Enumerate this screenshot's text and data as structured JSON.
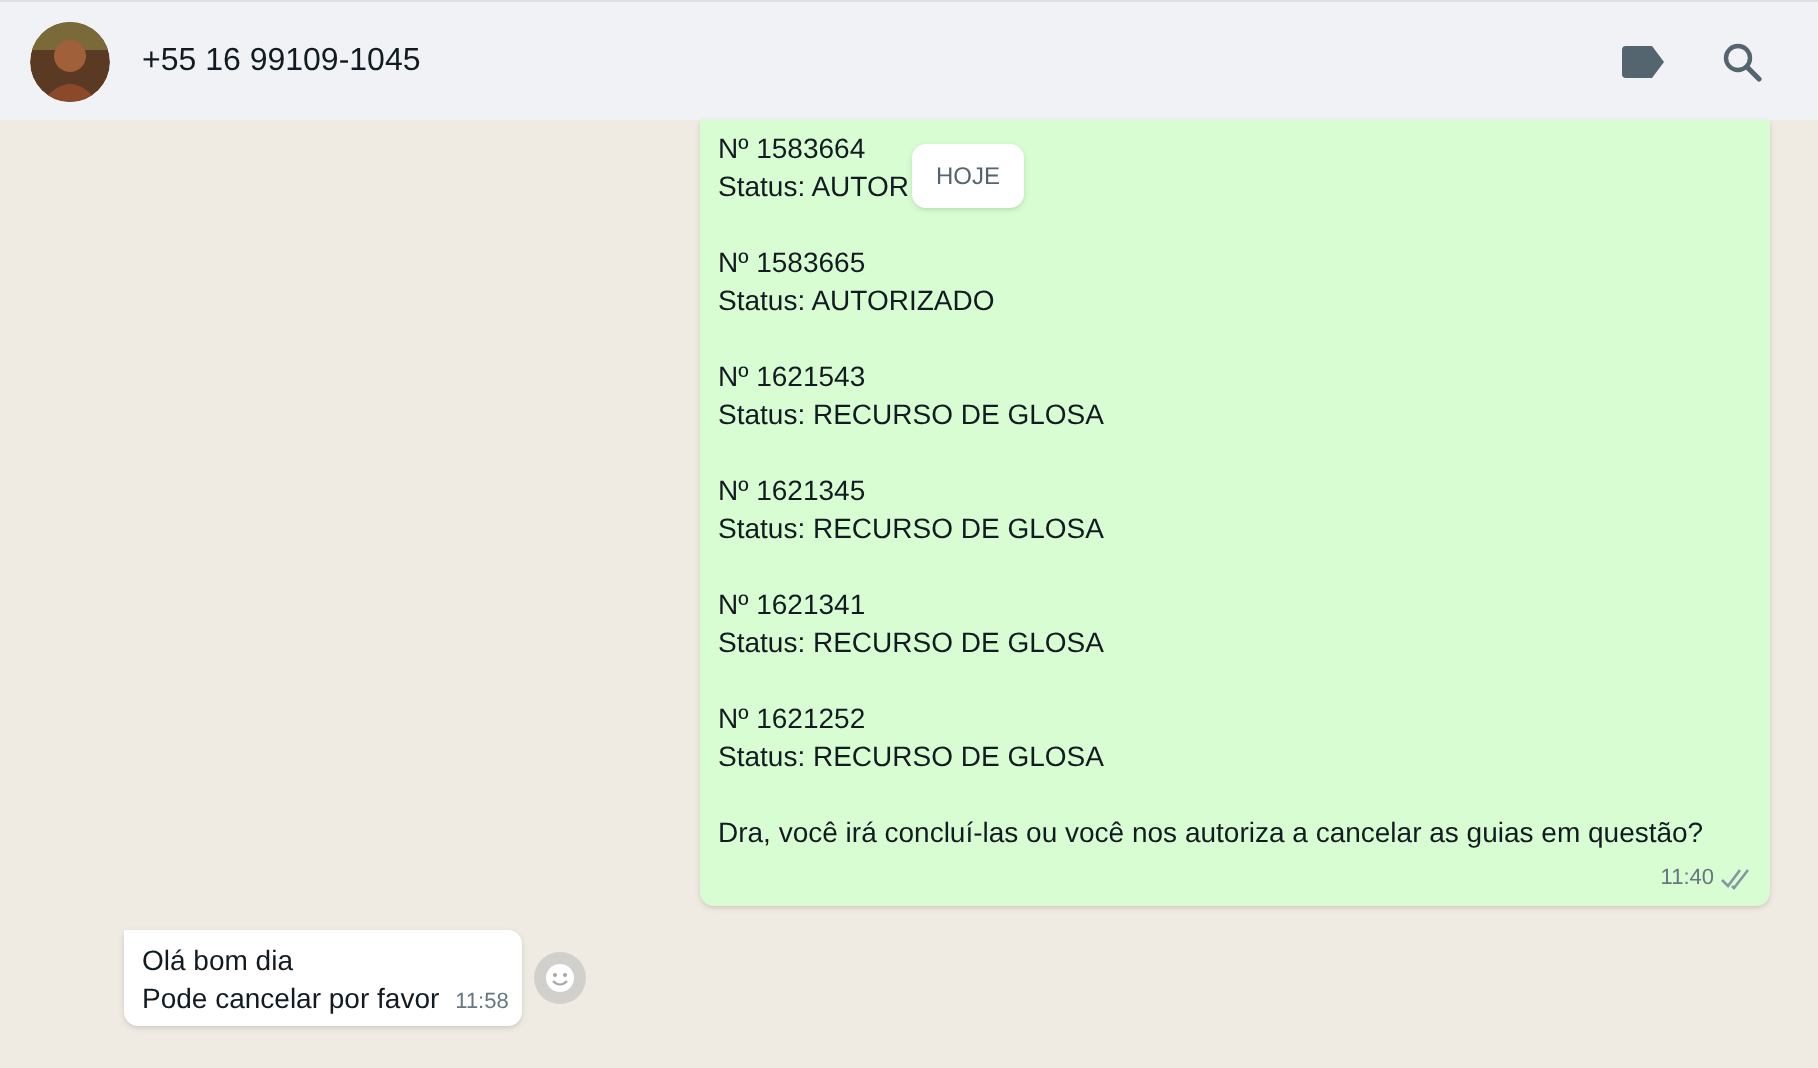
{
  "header": {
    "contact": "+55 16 99109-1045"
  },
  "date_badge": "HOJE",
  "outgoing": {
    "entries": [
      {
        "number": "Nº 1583664",
        "status": "Status: AUTOR"
      },
      {
        "number": "Nº 1583665",
        "status": "Status: AUTORIZADO"
      },
      {
        "number": "Nº 1621543",
        "status": "Status: RECURSO DE GLOSA"
      },
      {
        "number": "Nº 1621345",
        "status": "Status: RECURSO DE GLOSA"
      },
      {
        "number": "Nº 1621341",
        "status": "Status: RECURSO DE GLOSA"
      },
      {
        "number": "Nº 1621252",
        "status": "Status: RECURSO DE GLOSA"
      }
    ],
    "question": "Dra, você irá concluí-las ou você nos autoriza a cancelar as guias em questão?",
    "time": "11:40",
    "read": false
  },
  "incoming": {
    "lines": [
      "Olá bom dia",
      "Pode cancelar por favor"
    ],
    "time": "11:58"
  }
}
